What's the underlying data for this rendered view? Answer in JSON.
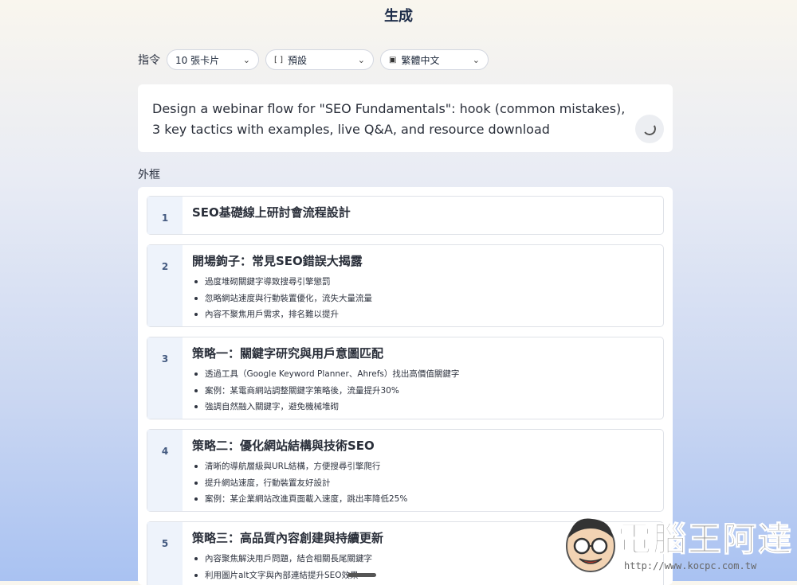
{
  "header": {
    "title": "生成"
  },
  "toolbar": {
    "label": "指令",
    "selects": [
      {
        "icon": "",
        "value": "10 張卡片"
      },
      {
        "icon": "aspect-ratio-icon",
        "value": "預設"
      },
      {
        "icon": "language-icon",
        "value": "繁體中文"
      }
    ]
  },
  "prompt": {
    "text": "Design a webinar flow for \"SEO Fundamentals\": hook (common mistakes), 3 key tactics with examples, live Q&A, and resource download"
  },
  "outline": {
    "label": "外框",
    "cards": [
      {
        "num": "1",
        "title": "SEO基礎線上研討會流程設計",
        "bullets": []
      },
      {
        "num": "2",
        "title": "開場鉤子：常見SEO錯誤大揭露",
        "bullets": [
          "過度堆砌關鍵字導致搜尋引擎懲罰",
          "忽略網站速度與行動裝置優化，流失大量流量",
          "內容不聚焦用戶需求，排名難以提升"
        ]
      },
      {
        "num": "3",
        "title": "策略一：關鍵字研究與用戶意圖匹配",
        "bullets": [
          "透過工具（Google Keyword Planner、Ahrefs）找出高價值關鍵字",
          "案例：某電商網站調整關鍵字策略後，流量提升30%",
          "強調自然融入關鍵字，避免機械堆砌"
        ]
      },
      {
        "num": "4",
        "title": "策略二：優化網站結構與技術SEO",
        "bullets": [
          "清晰的導航層級與URL結構，方便搜尋引擎爬行",
          "提升網站速度，行動裝置友好設計",
          "案例：某企業網站改進頁面載入速度，跳出率降低25%"
        ]
      },
      {
        "num": "5",
        "title": "策略三：高品質內容創建與持續更新",
        "bullets": [
          "內容聚焦解決用戶問題，結合相關長尾關鍵字",
          "利用圖片alt文字與內部連結提升SEO效果"
        ]
      }
    ]
  },
  "watermark": {
    "text": "電腦王阿達",
    "url": "http://www.kocpc.com.tw"
  }
}
